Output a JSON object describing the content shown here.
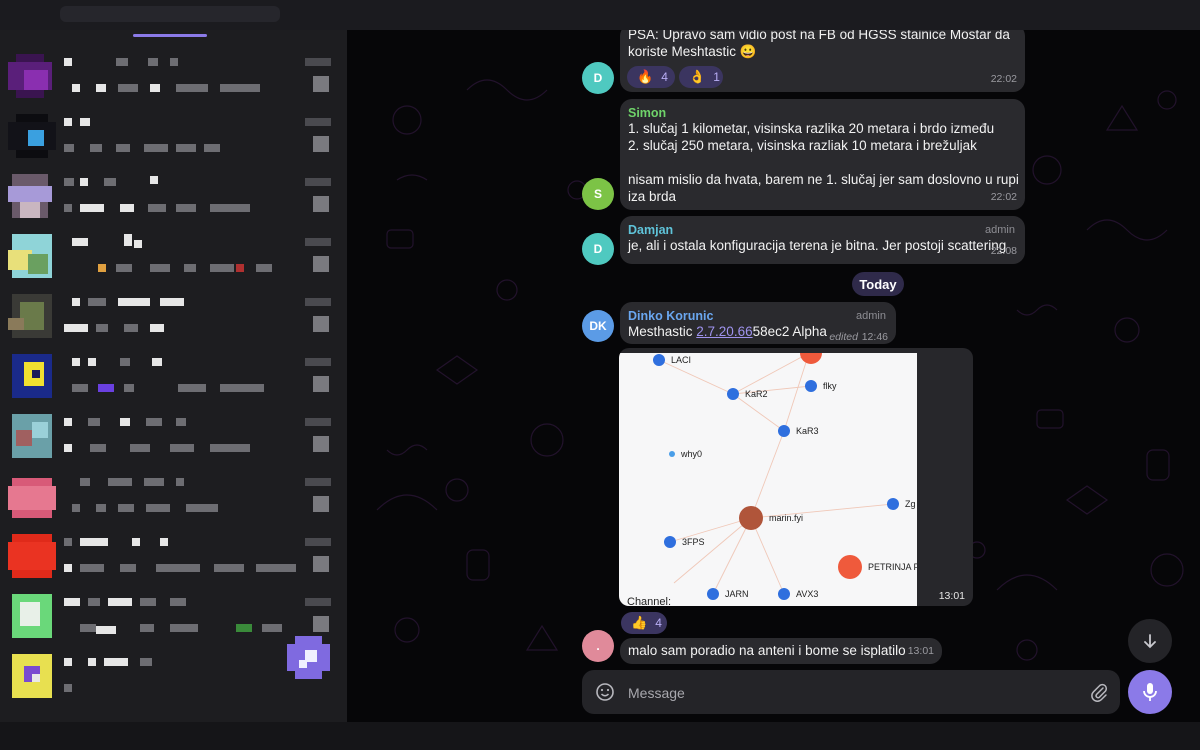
{
  "messages": [
    {
      "id": "m1",
      "avatar": "D",
      "avatar_color": "#4fc9c0",
      "text_line1": "PSA: Upravo sam vidio post na FB od HGSS stainice Mostar da",
      "text_line2": "koriste Meshtastic 😀",
      "time": "22:02",
      "reactions": [
        {
          "emoji": "🔥",
          "count": "4"
        },
        {
          "emoji": "👌",
          "count": "1"
        }
      ]
    },
    {
      "id": "m2",
      "sender": "Simon",
      "sender_color": "#6fd36a",
      "avatar": "S",
      "avatar_color": "#7cc346",
      "line1": "1. slučaj 1 kilometar, visinska razlika 20 metara i brdo između",
      "line2": "2. slučaj 250 metara, visinska razliak 10 metara i brežuljak",
      "line3": "nisam mislio da hvata, barem ne 1. slučaj jer sam doslovno u rupi",
      "line4": "iza brda",
      "time": "22:02"
    },
    {
      "id": "m3",
      "sender": "Damjan",
      "sender_color": "#5fc3d9",
      "role": "admin",
      "avatar": "D",
      "avatar_color": "#4fc9c0",
      "text": "je, ali i ostala konfiguracija terena je bitna. Jer postoji scattering",
      "time": "22:08"
    },
    {
      "id": "m4",
      "sender": "Dinko Korunic",
      "sender_color": "#6aa7f0",
      "role": "admin",
      "avatar": "DK",
      "avatar_color": "#5b9be6",
      "text_prefix": "Mesthastic ",
      "link_text": "2.7.20.66",
      "text_suffix": "58ec2 Alpha",
      "edited_label": "edited",
      "time": "12:46"
    },
    {
      "id": "m5",
      "time": "13:01",
      "reactions": [
        {
          "emoji": "👍",
          "count": "4"
        }
      ],
      "partial_text": "Channel:"
    },
    {
      "id": "m6",
      "avatar": ".",
      "avatar_color": "#e08a9a",
      "text": "malo sam poradio na anteni i bome se isplatilo",
      "time": "13:01"
    }
  ],
  "date_separator": "Today",
  "graph_nodes": [
    {
      "id": "laci",
      "label": "LACI",
      "color": "#2f6fde"
    },
    {
      "id": "kar2",
      "label": "KaR2",
      "color": "#2f6fde"
    },
    {
      "id": "flky",
      "label": "flky",
      "color": "#2f6fde"
    },
    {
      "id": "kar3",
      "label": "KaR3",
      "color": "#2f6fde"
    },
    {
      "id": "why0",
      "label": "why0",
      "color": "#4a9ee8"
    },
    {
      "id": "marin",
      "label": "marin.fyi",
      "color": "#b0553a"
    },
    {
      "id": "zg",
      "label": "Zg",
      "color": "#2f6fde"
    },
    {
      "id": "3fps",
      "label": "3FPS",
      "color": "#2f6fde"
    },
    {
      "id": "petrinja",
      "label": "PETRINJA F",
      "color": "#ef5a3c"
    },
    {
      "id": "jarn",
      "label": "JARN",
      "color": "#2f6fde"
    },
    {
      "id": "avx3",
      "label": "AVX3",
      "color": "#2f6fde"
    }
  ],
  "composer": {
    "placeholder": "Message"
  },
  "icons": {
    "emoji": "emoji-icon",
    "attach": "paperclip-icon",
    "mic": "microphone-icon",
    "scroll": "arrow-down-icon"
  },
  "colors": {
    "accent": "#8b7ae8",
    "bubble": "#2a2a2e",
    "sidebar": "#1d1d20"
  }
}
